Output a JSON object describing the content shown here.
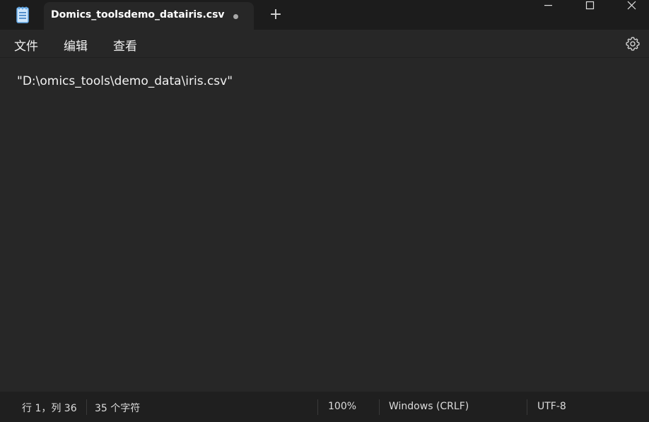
{
  "titlebar": {
    "tab_title": "Domics_toolsdemo_datairis.csv",
    "new_tab_symbol": "+",
    "app_icon": "notepad-icon",
    "window_controls": [
      "minimize-icon",
      "maximize-icon",
      "close-icon"
    ]
  },
  "menu": {
    "file": "文件",
    "edit": "编辑",
    "view": "查看",
    "settings_icon": "gear-icon"
  },
  "editor": {
    "content": "\"D:\\omics_tools\\demo_data\\iris.csv\""
  },
  "status": {
    "position": "行 1，列 36",
    "char_count": "35 个字符",
    "zoom": "100%",
    "line_ending": "Windows (CRLF)",
    "encoding": "UTF-8"
  },
  "colors": {
    "titlebar_bg": "#1c1c1c",
    "editor_bg": "#272727",
    "statusbar_bg": "#1f1f1f",
    "icon_accent": "#62a8e8"
  }
}
